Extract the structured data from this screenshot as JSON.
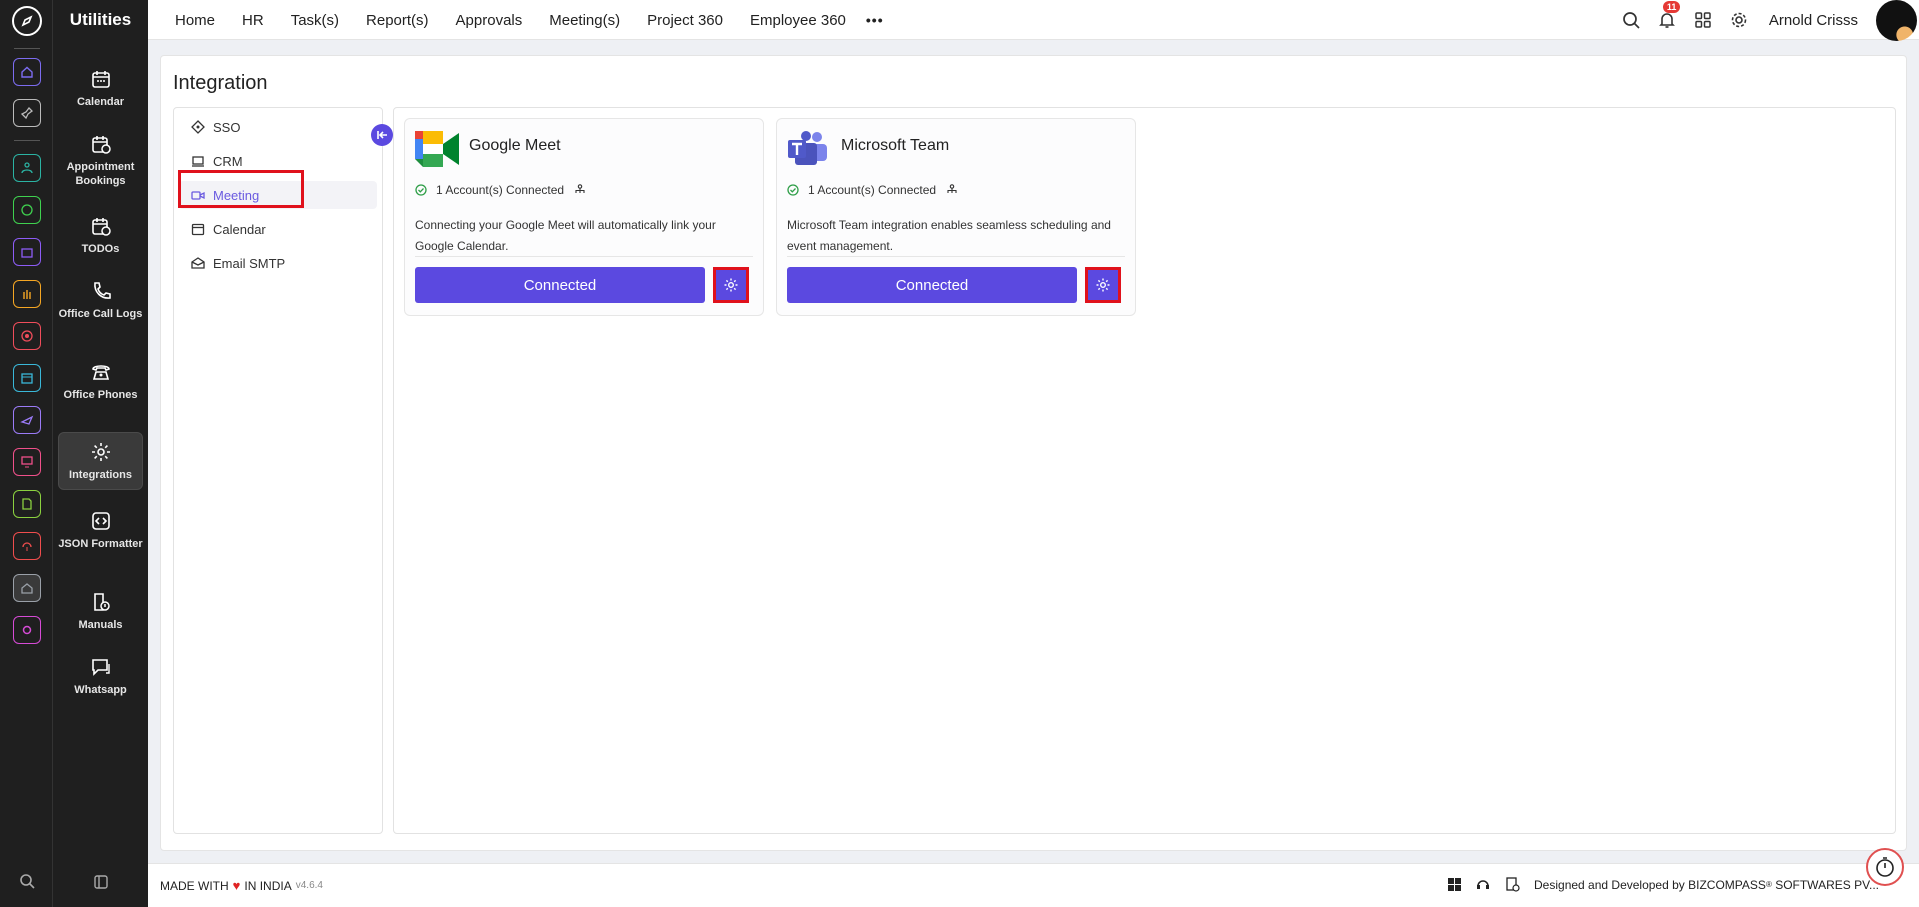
{
  "app": {
    "section_title": "Utilities"
  },
  "topnav": {
    "items": [
      "Home",
      "HR",
      "Task(s)",
      "Report(s)",
      "Approvals",
      "Meeting(s)",
      "Project 360",
      "Employee 360"
    ],
    "more": "•••",
    "notification_count": "11",
    "user_name": "Arnold Crisss"
  },
  "rail": {
    "icons": [
      {
        "name": "home-icon",
        "color": "#7c6cf0"
      },
      {
        "name": "pin-icon",
        "color": "#bbbbbb"
      },
      {
        "name": "people-icon",
        "color": "#2bb3a3"
      },
      {
        "name": "money-icon",
        "color": "#3fd14f"
      },
      {
        "name": "briefcase-icon",
        "color": "#8d5cf6"
      },
      {
        "name": "hand-icon",
        "color": "#f5a623"
      },
      {
        "name": "target-icon",
        "color": "#f04d5b"
      },
      {
        "name": "archive-icon",
        "color": "#3ab8d9"
      },
      {
        "name": "plane-icon",
        "color": "#9b7bf7"
      },
      {
        "name": "monitor-icon",
        "color": "#f0508a"
      },
      {
        "name": "document-icon",
        "color": "#8bd13f"
      },
      {
        "name": "support-icon",
        "color": "#f04d4d"
      },
      {
        "name": "house-icon",
        "color": "#9aa0a8"
      },
      {
        "name": "settings-icon",
        "color": "#d64bd6"
      }
    ]
  },
  "sidebar": {
    "items": [
      {
        "label": "Calendar",
        "icon": "calendar-icon"
      },
      {
        "label": "Appointment Bookings",
        "icon": "calendar-clock-icon"
      },
      {
        "label": "TODOs",
        "icon": "todo-icon"
      },
      {
        "label": "Office Call Logs",
        "icon": "phone-icon"
      },
      {
        "label": "Office Phones",
        "icon": "desk-phone-icon"
      },
      {
        "label": "Integrations",
        "icon": "gear-icon"
      },
      {
        "label": "JSON Formatter",
        "icon": "code-icon"
      },
      {
        "label": "Manuals",
        "icon": "manual-icon"
      },
      {
        "label": "Whatsapp",
        "icon": "chat-icon"
      }
    ]
  },
  "page": {
    "title": "Integration",
    "menu": [
      "SSO",
      "CRM",
      "Meeting",
      "Calendar",
      "Email SMTP"
    ],
    "active_menu": "Meeting"
  },
  "cards": [
    {
      "name": "Google Meet",
      "status": "1 Account(s) Connected",
      "description": "Connecting your Google Meet will automatically link your Google Calendar.",
      "button": "Connected"
    },
    {
      "name": "Microsoft Team",
      "status": "1 Account(s) Connected",
      "description": "Microsoft Team integration enables seamless scheduling and event management.",
      "button": "Connected"
    }
  ],
  "footer": {
    "made_with": "MADE WITH",
    "in_india": "IN INDIA",
    "version": "v4.6.4",
    "designed_by": "Designed and Developed by",
    "company": "BIZCOMPASS",
    "reg": "®",
    "company_suffix": "SOFTWARES PV..."
  }
}
